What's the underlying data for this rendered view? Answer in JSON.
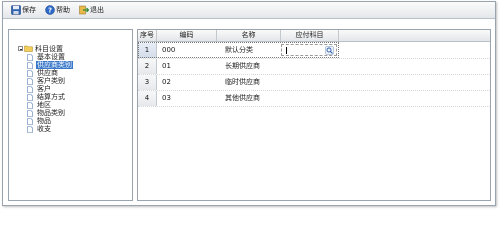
{
  "toolbar": {
    "buttons": [
      {
        "label": "保存",
        "icon": "save-icon"
      },
      {
        "label": "帮助",
        "icon": "help-icon"
      },
      {
        "label": "退出",
        "icon": "exit-icon"
      }
    ]
  },
  "tree": {
    "root": "科目设置",
    "items": [
      "基本设置",
      "供应商类别",
      "供应商",
      "客户类别",
      "客户",
      "结算方式",
      "地区",
      "物品类别",
      "物品",
      "收支"
    ],
    "selected_index": 1
  },
  "grid": {
    "headers": {
      "num": "序号",
      "code": "编码",
      "name": "名称",
      "account": "应付科目"
    },
    "rows": [
      {
        "num": "1",
        "code": "000",
        "name": "默认分类",
        "account": ""
      },
      {
        "num": "2",
        "code": "01",
        "name": "长期供应商",
        "account": ""
      },
      {
        "num": "3",
        "code": "02",
        "name": "临时供应商",
        "account": ""
      },
      {
        "num": "4",
        "code": "03",
        "name": "其他供应商",
        "account": ""
      }
    ],
    "selected_row": 0
  },
  "colors": {
    "selection": "#3a78c9",
    "border": "#9aa4ae",
    "header": "#e3e6e9"
  }
}
